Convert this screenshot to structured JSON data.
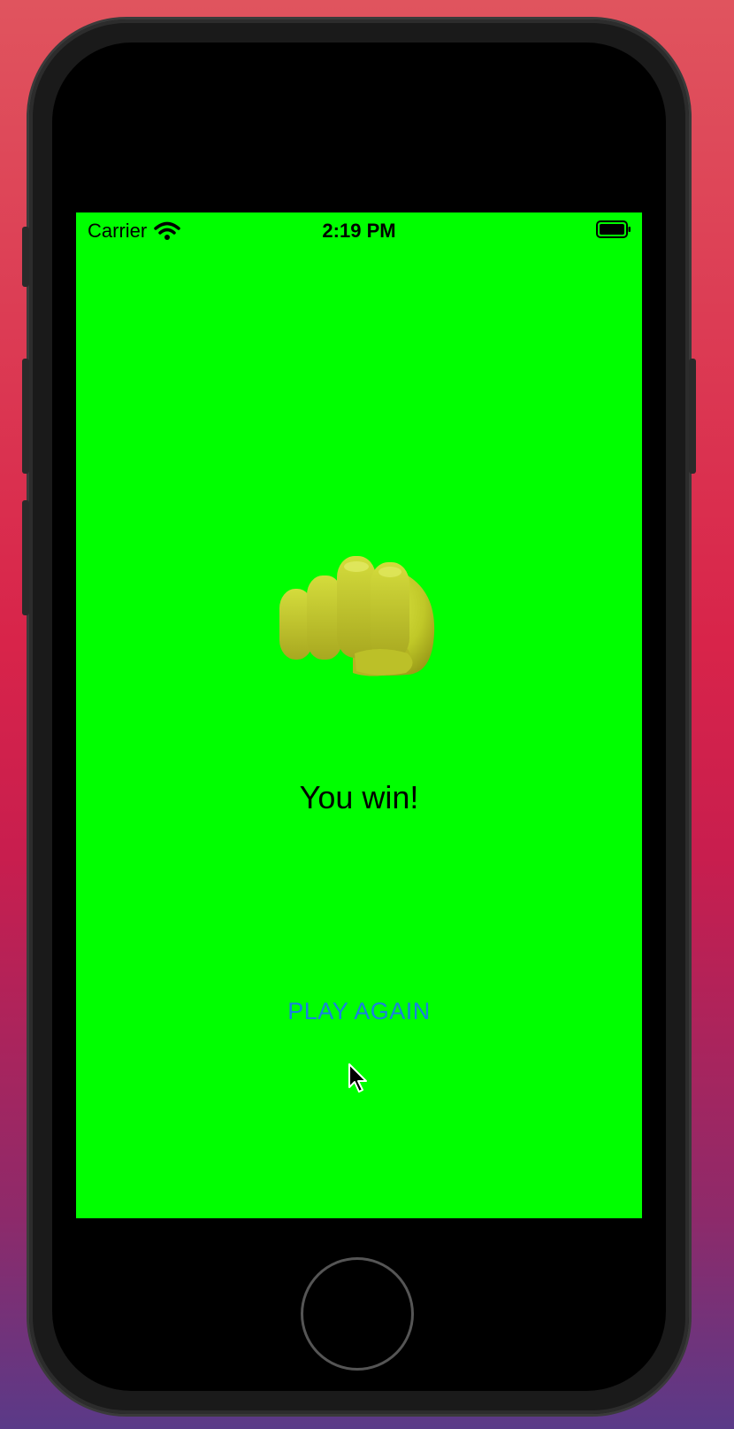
{
  "status_bar": {
    "carrier": "Carrier",
    "time": "2:19 PM"
  },
  "game": {
    "hand_icon": "oncoming-fist",
    "result_text": "You win!",
    "play_again_label": "PLAY AGAIN",
    "background_color": "#00ff00",
    "button_color": "#1a7fe0"
  }
}
